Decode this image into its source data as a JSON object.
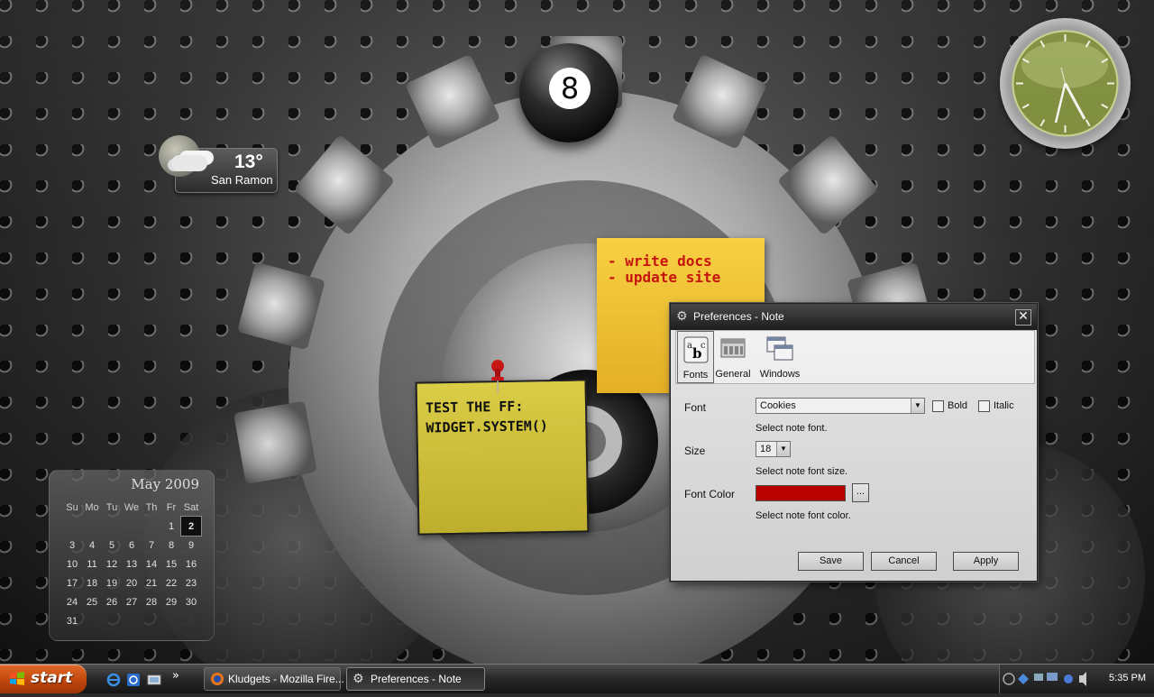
{
  "widgets": {
    "eight_ball": {
      "number": "8"
    },
    "weather": {
      "temperature": "13°",
      "city": "San Ramon"
    },
    "calendar": {
      "month_year": "May 2009",
      "weekdays": [
        "Su",
        "Mo",
        "Tu",
        "We",
        "Th",
        "Fr",
        "Sat"
      ],
      "weeks": [
        [
          "",
          "",
          "",
          "",
          "",
          "1",
          "2"
        ],
        [
          "3",
          "4",
          "5",
          "6",
          "7",
          "8",
          "9"
        ],
        [
          "10",
          "11",
          "12",
          "13",
          "14",
          "15",
          "16"
        ],
        [
          "17",
          "18",
          "19",
          "20",
          "21",
          "22",
          "23"
        ],
        [
          "24",
          "25",
          "26",
          "27",
          "28",
          "29",
          "30"
        ],
        [
          "31",
          "",
          "",
          "",
          "",
          "",
          ""
        ]
      ],
      "today": "2"
    },
    "note_orange": {
      "line1": "- write docs",
      "line2": "- update site"
    },
    "note_yellow": {
      "line1": "TEST THE FF:",
      "line2": "WIDGET.SYSTEM()"
    }
  },
  "dialog": {
    "title": "Preferences - Note",
    "close_glyph": "✕",
    "tabs": [
      {
        "label": "Fonts",
        "selected": true
      },
      {
        "label": "General",
        "selected": false
      },
      {
        "label": "Windows",
        "selected": false
      }
    ],
    "font": {
      "label": "Font",
      "value": "Cookies",
      "bold_label": "Bold",
      "italic_label": "Italic",
      "bold_checked": false,
      "italic_checked": false,
      "help": "Select note font."
    },
    "size": {
      "label": "Size",
      "value": "18",
      "help": "Select note font size."
    },
    "color": {
      "label": "Font Color",
      "value": "#cc0000",
      "picker_label": "...",
      "help": "Select note font color."
    },
    "buttons": {
      "save": "Save",
      "cancel": "Cancel",
      "apply": "Apply"
    }
  },
  "taskbar": {
    "start_label": "start",
    "overflow_glyph": "»",
    "tasks": [
      {
        "label": "Kludgets - Mozilla Fire...",
        "active": false
      },
      {
        "label": "Preferences - Note",
        "active": true
      }
    ],
    "clock": "5:35 PM"
  },
  "colors": {
    "start_orange": "#c44a0e",
    "note_orange": "#f0b928",
    "note_yellow": "#d4c232",
    "note_text_red": "#c8140e",
    "clock_face_green": "#8a9a4a"
  }
}
